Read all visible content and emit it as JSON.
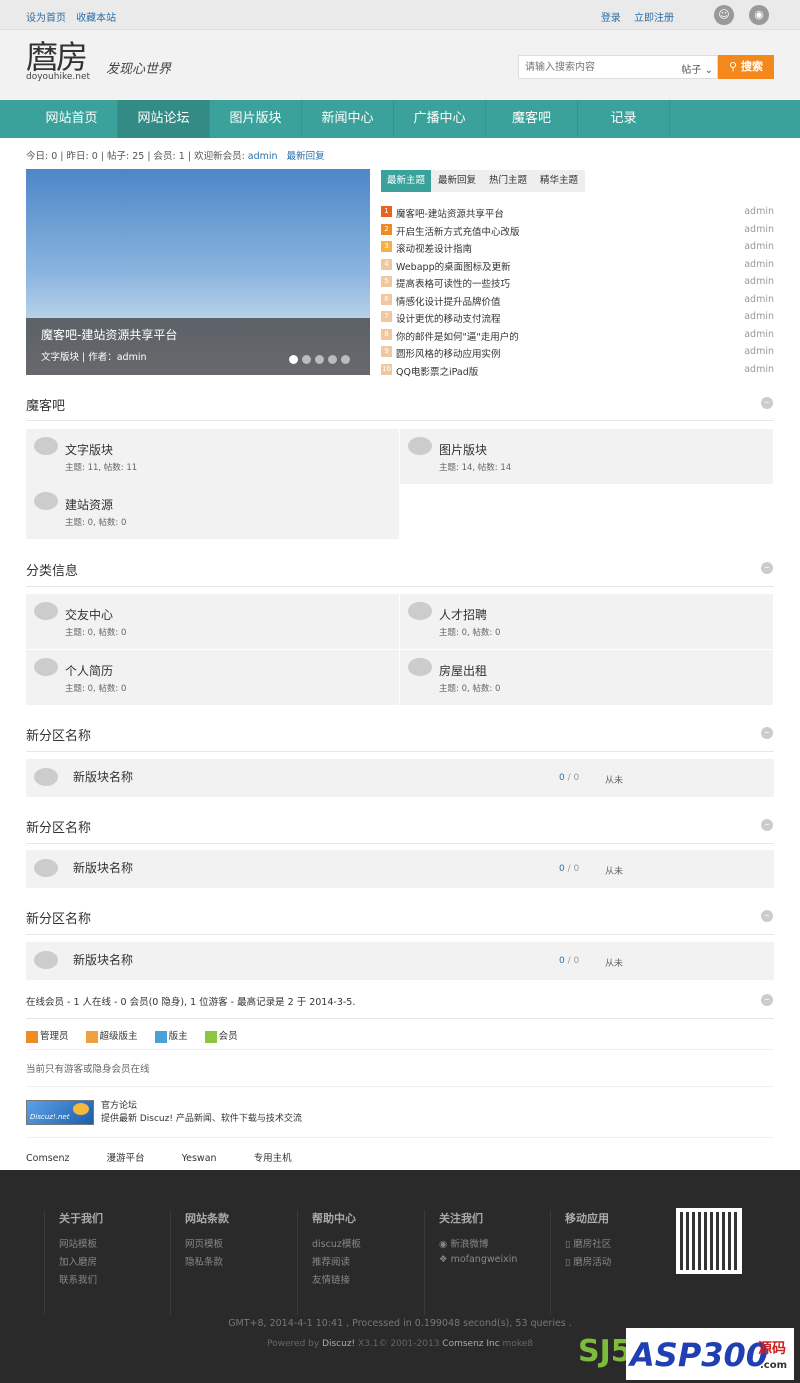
{
  "topbar": {
    "left": [
      "设为首页",
      "收藏本站"
    ],
    "right": [
      "登录",
      "立即注册"
    ]
  },
  "header": {
    "logo": "麿房",
    "logo_sub": "doyouhike.net",
    "slogan": "发现心世界"
  },
  "search": {
    "placeholder": "请输入搜索内容",
    "scope": "帖子",
    "button": "搜索"
  },
  "nav": [
    "网站首页",
    "网站论坛",
    "图片版块",
    "新闻中心",
    "广播中心",
    "魔客吧",
    "记录"
  ],
  "stats": {
    "text": "今日: 0 | 昨日: 0 | 帖子: 25 | 会员: 1 | 欢迎新会员:",
    "user": "admin",
    "latest": "最新回复"
  },
  "slide": {
    "title": "魔客吧-建站资源共享平台",
    "meta": "文字版块 | 作者：admin"
  },
  "tabs": [
    "最新主题",
    "最新回复",
    "热门主题",
    "精华主题"
  ],
  "topics": [
    {
      "n": "1",
      "t": "魔客吧-建站资源共享平台",
      "a": "admin"
    },
    {
      "n": "2",
      "t": "开启生活新方式充值中心改版",
      "a": "admin"
    },
    {
      "n": "3",
      "t": "滚动视差设计指南",
      "a": "admin"
    },
    {
      "n": "4",
      "t": "Webapp的桌面图标及更新",
      "a": "admin"
    },
    {
      "n": "5",
      "t": "提高表格可读性的一些技巧",
      "a": "admin"
    },
    {
      "n": "6",
      "t": "情感化设计提升品牌价值",
      "a": "admin"
    },
    {
      "n": "7",
      "t": "设计更优的移动支付流程",
      "a": "admin"
    },
    {
      "n": "8",
      "t": "你的邮件是如何\"逼\"走用户的",
      "a": "admin"
    },
    {
      "n": "9",
      "t": "圆形风格的移动应用实例",
      "a": "admin"
    },
    {
      "n": "10",
      "t": "QQ电影票之iPad版",
      "a": "admin"
    }
  ],
  "sections": {
    "s1": {
      "title": "魔客吧",
      "forums": [
        {
          "name": "文字版块",
          "meta": "主题: 11, 帖数: 11"
        },
        {
          "name": "图片版块",
          "meta": "主题: 14, 帖数: 14"
        },
        {
          "name": "建站资源",
          "meta": "主题: 0, 帖数: 0"
        }
      ]
    },
    "s2": {
      "title": "分类信息",
      "forums": [
        {
          "name": "交友中心",
          "meta": "主题: 0, 帖数: 0"
        },
        {
          "name": "人才招聘",
          "meta": "主题: 0, 帖数: 0"
        },
        {
          "name": "个人简历",
          "meta": "主题: 0, 帖数: 0"
        },
        {
          "name": "房屋出租",
          "meta": "主题: 0, 帖数: 0"
        }
      ]
    },
    "new": [
      {
        "title": "新分区名称",
        "forum": "新版块名称",
        "c1": "0",
        "c2": " / 0",
        "last": "从未"
      },
      {
        "title": "新分区名称",
        "forum": "新版块名称",
        "c1": "0",
        "c2": " / 0",
        "last": "从未"
      },
      {
        "title": "新分区名称",
        "forum": "新版块名称",
        "c1": "0",
        "c2": " / 0",
        "last": "从未"
      }
    ]
  },
  "online": {
    "text": "在线会员 - 1 人在线 - 0 会员(0 隐身), 1 位游客 - 最高记录是 2 于 2014-3-5.",
    "legend": [
      "管理员",
      "超级版主",
      "版主",
      "会员"
    ],
    "legend_colors": [
      "#f08a24",
      "#f0a040",
      "#4aa0d8",
      "#8cc63e"
    ],
    "note": "当前只有游客或隐身会员在线"
  },
  "partner": {
    "logo": "Discuz!.net",
    "name": "官方论坛",
    "desc": "提供最新 Discuz! 产品新闻、软件下载与技术交流"
  },
  "links": [
    "Comsenz",
    "漫游平台",
    "Yeswan",
    "专用主机"
  ],
  "footer": {
    "cols": [
      {
        "h": "关于我们",
        "items": [
          "网站模板",
          "加入磨房",
          "联系我们"
        ]
      },
      {
        "h": "网站条款",
        "items": [
          "网页模板",
          "隐私条款"
        ]
      },
      {
        "h": "帮助中心",
        "items": [
          "discuz模板",
          "推荐阅读",
          "友情链接"
        ]
      },
      {
        "h": "关注我们",
        "items": [
          "新浪微博",
          "mofangweixin"
        ]
      },
      {
        "h": "移动应用",
        "items": [
          "磨房社区",
          "磨房活动"
        ]
      }
    ],
    "meta": "GMT+8, 2014-4-1 10:41 , Processed in 0.199048 second(s), 53 queries .",
    "powered": "Powered by",
    "discuz": "Discuz!",
    "ver": " X3.1© 2001-2013 ",
    "comsenz": "Comsenz Inc",
    "tail": " moke8"
  },
  "watermark": {
    "sj": "SJ5",
    "asp": "ASP300",
    "cn": "源码",
    "com": ".com"
  }
}
